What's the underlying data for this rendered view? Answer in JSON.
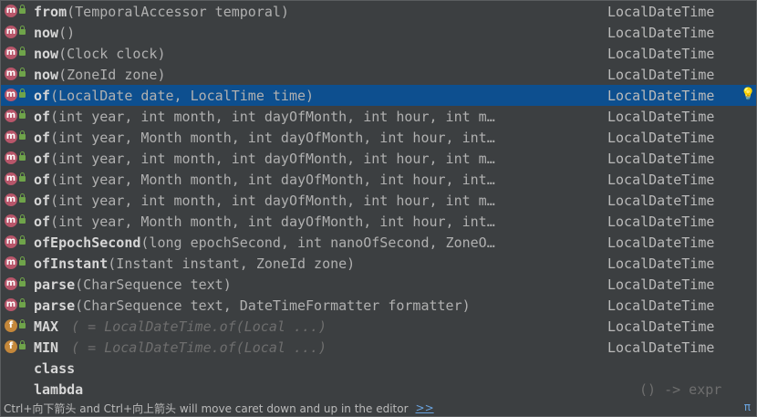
{
  "colors": {
    "background": "#3c3f41",
    "selection": "#0d4f8f",
    "method_icon": "#b8566a",
    "field_icon": "#c4873a"
  },
  "items": [
    {
      "kind": "method",
      "name": "from",
      "params": "(TemporalAccessor temporal)",
      "type": "LocalDateTime"
    },
    {
      "kind": "method",
      "name": "now",
      "params": "()",
      "type": "LocalDateTime"
    },
    {
      "kind": "method",
      "name": "now",
      "params": "(Clock clock)",
      "type": "LocalDateTime"
    },
    {
      "kind": "method",
      "name": "now",
      "params": "(ZoneId zone)",
      "type": "LocalDateTime"
    },
    {
      "kind": "method",
      "name": "of",
      "params": "(LocalDate date, LocalTime time)",
      "type": "LocalDateTime",
      "selected": true
    },
    {
      "kind": "method",
      "name": "of",
      "params": "(int year, int month, int dayOfMonth, int hour, int m…",
      "type": "LocalDateTime"
    },
    {
      "kind": "method",
      "name": "of",
      "params": "(int year, Month month, int dayOfMonth, int hour, int…",
      "type": "LocalDateTime"
    },
    {
      "kind": "method",
      "name": "of",
      "params": "(int year, int month, int dayOfMonth, int hour, int m…",
      "type": "LocalDateTime"
    },
    {
      "kind": "method",
      "name": "of",
      "params": "(int year, Month month, int dayOfMonth, int hour, int…",
      "type": "LocalDateTime"
    },
    {
      "kind": "method",
      "name": "of",
      "params": "(int year, int month, int dayOfMonth, int hour, int m…",
      "type": "LocalDateTime"
    },
    {
      "kind": "method",
      "name": "of",
      "params": "(int year, Month month, int dayOfMonth, int hour, int…",
      "type": "LocalDateTime"
    },
    {
      "kind": "method",
      "name": "ofEpochSecond",
      "params": "(long epochSecond, int nanoOfSecond, ZoneO…",
      "type": "LocalDateTime"
    },
    {
      "kind": "method",
      "name": "ofInstant",
      "params": "(Instant instant, ZoneId zone)",
      "type": "LocalDateTime"
    },
    {
      "kind": "method",
      "name": "parse",
      "params": "(CharSequence text)",
      "type": "LocalDateTime"
    },
    {
      "kind": "method",
      "name": "parse",
      "params": "(CharSequence text, DateTimeFormatter formatter)",
      "type": "LocalDateTime"
    },
    {
      "kind": "field",
      "name": "MAX",
      "params": "( = LocalDateTime.of(Local ...)",
      "type": "LocalDateTime"
    },
    {
      "kind": "field",
      "name": "MIN",
      "params": "( = LocalDateTime.of(Local ...)",
      "type": "LocalDateTime"
    },
    {
      "kind": "keyword",
      "name": "class",
      "params": "",
      "type": ""
    },
    {
      "kind": "template",
      "name": "lambda",
      "params": "",
      "type": "() -> expr"
    }
  ],
  "footer": {
    "hint": "Ctrl+向下箭头 and Ctrl+向上箭头 will move caret down and up in the editor",
    "link": ">>",
    "pi": "π"
  }
}
